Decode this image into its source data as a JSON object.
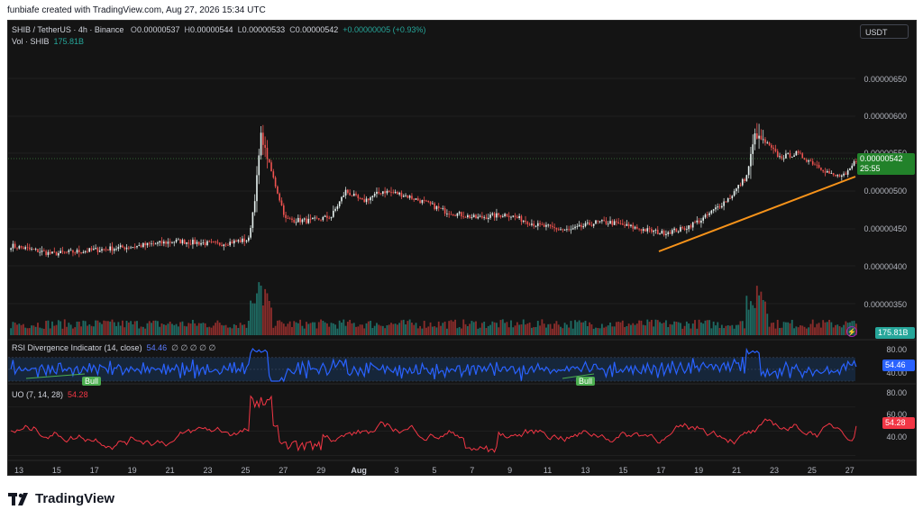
{
  "header": {
    "text": "funbiafe created with TradingView.com, Aug 27, 2026 15:34 UTC"
  },
  "legend": {
    "symbol": "SHIB / TetherUS · 4h · Binance",
    "o_label": "O",
    "o": "0.00000537",
    "h_label": "H",
    "h": "0.00000544",
    "l_label": "L",
    "l": "0.00000533",
    "c_label": "C",
    "c": "0.00000542",
    "change": "+0.00000005 (+0.93%)",
    "vol_label": "Vol · SHIB",
    "vol_value": "175.81B"
  },
  "currency_button": "USDT",
  "rsi": {
    "title": "RSI Divergence Indicator (14, close)",
    "value": "54.46",
    "extra": "∅ ∅ ∅ ∅ ∅",
    "bull_label": "Bull"
  },
  "uo": {
    "title": "UO (7, 14, 28)",
    "value": "54.28"
  },
  "price_axis": [
    "0.00000650",
    "0.00000600",
    "0.00000550",
    "0.00000500",
    "0.00000450",
    "0.00000400",
    "0.00000350"
  ],
  "last_price_tag": {
    "price": "0.00000542",
    "countdown": "25:55"
  },
  "volume_tag": "175.81B",
  "rsi_axis": [
    "80.00",
    "40.00"
  ],
  "rsi_tag": "54.46",
  "uo_axis": [
    "80.00",
    "60.00",
    "40.00"
  ],
  "uo_tag": "54.28",
  "x_axis": [
    "13",
    "15",
    "17",
    "19",
    "21",
    "23",
    "25",
    "27",
    "29",
    "Aug",
    "3",
    "5",
    "7",
    "9",
    "11",
    "13",
    "15",
    "17",
    "19",
    "21",
    "23",
    "25",
    "27"
  ],
  "colors": {
    "up": "#26a69a",
    "down": "#ef5350",
    "rsi": "#2962ff",
    "uo": "#f23645",
    "trend": "#f7931a",
    "bg": "#141414"
  },
  "footer": {
    "brand": "TradingView"
  },
  "chart_data": {
    "type": "candlestick",
    "title": "SHIB / TetherUS · 4h · Binance",
    "timeframe": "4h",
    "x_range": [
      "Jul 13",
      "Aug 27"
    ],
    "ylim": [
      3.2e-06,
      6.8e-06
    ],
    "close_anchors": [
      [
        0,
        4.27e-06
      ],
      [
        20,
        4.16e-06
      ],
      [
        40,
        4.21e-06
      ],
      [
        60,
        4.26e-06
      ],
      [
        80,
        4.33e-06
      ],
      [
        100,
        4.29e-06
      ],
      [
        115,
        4.35e-06
      ],
      [
        118,
        4.9e-06
      ],
      [
        121,
        5.75e-06
      ],
      [
        125,
        5.35e-06
      ],
      [
        133,
        4.62e-06
      ],
      [
        145,
        4.6e-06
      ],
      [
        155,
        4.66e-06
      ],
      [
        162,
        5e-06
      ],
      [
        170,
        4.86e-06
      ],
      [
        180,
        5e-06
      ],
      [
        190,
        4.95e-06
      ],
      [
        200,
        4.85e-06
      ],
      [
        210,
        4.73e-06
      ],
      [
        225,
        4.64e-06
      ],
      [
        240,
        4.69e-06
      ],
      [
        255,
        4.54e-06
      ],
      [
        270,
        4.47e-06
      ],
      [
        283,
        4.58e-06
      ],
      [
        290,
        4.58e-06
      ],
      [
        305,
        4.49e-06
      ],
      [
        315,
        4.44e-06
      ],
      [
        325,
        4.49e-06
      ],
      [
        335,
        4.63e-06
      ],
      [
        348,
        4.92e-06
      ],
      [
        356,
        5.2e-06
      ],
      [
        360,
        5.75e-06
      ],
      [
        365,
        5.65e-06
      ],
      [
        372,
        5.45e-06
      ],
      [
        380,
        5.5e-06
      ],
      [
        390,
        5.35e-06
      ],
      [
        398,
        5.2e-06
      ],
      [
        404,
        5.2e-06
      ],
      [
        409,
        5.42e-06
      ]
    ],
    "volume_max": "~1.6x recent average near Jul 26 and Aug 22",
    "volume_last": "175.81B",
    "rsi_series": {
      "name": "RSI",
      "last": 54.46,
      "range": [
        30,
        85
      ]
    },
    "uo_series": {
      "name": "UO",
      "last": 54.28,
      "range": [
        28,
        82
      ]
    },
    "trendline": {
      "from": [
        "Aug 17",
        4.2e-06
      ],
      "to": [
        "Aug 27",
        5.2e-06
      ]
    }
  }
}
